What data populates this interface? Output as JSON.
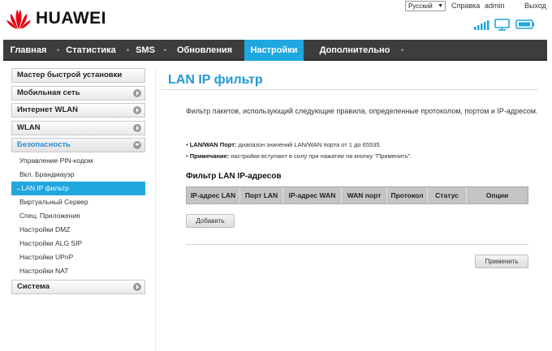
{
  "brand": {
    "name": "HUAWEI",
    "logo_icon": "huawei-petal-logo",
    "logo_color": "#e60012"
  },
  "top_bar": {
    "language": "Русский",
    "help": "Справка",
    "user": "admin",
    "logout": "Выход"
  },
  "status_icons": [
    "signal-bars-icon",
    "computer-icon",
    "battery-icon"
  ],
  "nav": {
    "items": [
      {
        "label": "Главная"
      },
      {
        "label": "Статистика"
      },
      {
        "label": "SMS"
      },
      {
        "label": "Обновления"
      },
      {
        "label": "Настройки",
        "active": true
      },
      {
        "label": "Дополнительно"
      }
    ],
    "active_color": "#1fa7e0"
  },
  "sidebar": {
    "quick_setup": "Мастер быстрой установки",
    "groups": [
      {
        "label": "Мобильная сеть"
      },
      {
        "label": "Интернет WLAN"
      },
      {
        "label": "WLAN"
      },
      {
        "label": "Безопасность",
        "expanded": true
      },
      {
        "label": "Система"
      }
    ],
    "security_items": [
      "Управление PIN-кодом",
      "Вкл. Брандмауэр",
      "LAN IP фильтр",
      "Виртуальный Сервер",
      "Спец. Приложения",
      "Настройки DMZ",
      "Настройки ALG SIP",
      "Настройки UPnP",
      "Настройки NAT"
    ],
    "active_item_prefix": "→"
  },
  "main": {
    "title": "LAN IP фильтр",
    "intro": "Фильтр пакетов, использующий следующие правила, определенные протоколом, портом и IP-адресом.",
    "notes": [
      {
        "label": "LAN/WAN Порт:",
        "text": "диапазон значений LAN/WAN порта от 1 до 65535."
      },
      {
        "label": "Примечание:",
        "text": "настройки вступают в силу при нажатии на кнопку \"Применить\"."
      }
    ],
    "table_title": "Фильтр LAN IP-адресов",
    "columns": [
      "IP-адрес LAN",
      "Порт LAN",
      "IP-адрес WAN",
      "WAN порт",
      "Протокол",
      "Статус",
      "Опции"
    ],
    "add_button": "Добавить",
    "apply_button": "Применить"
  }
}
